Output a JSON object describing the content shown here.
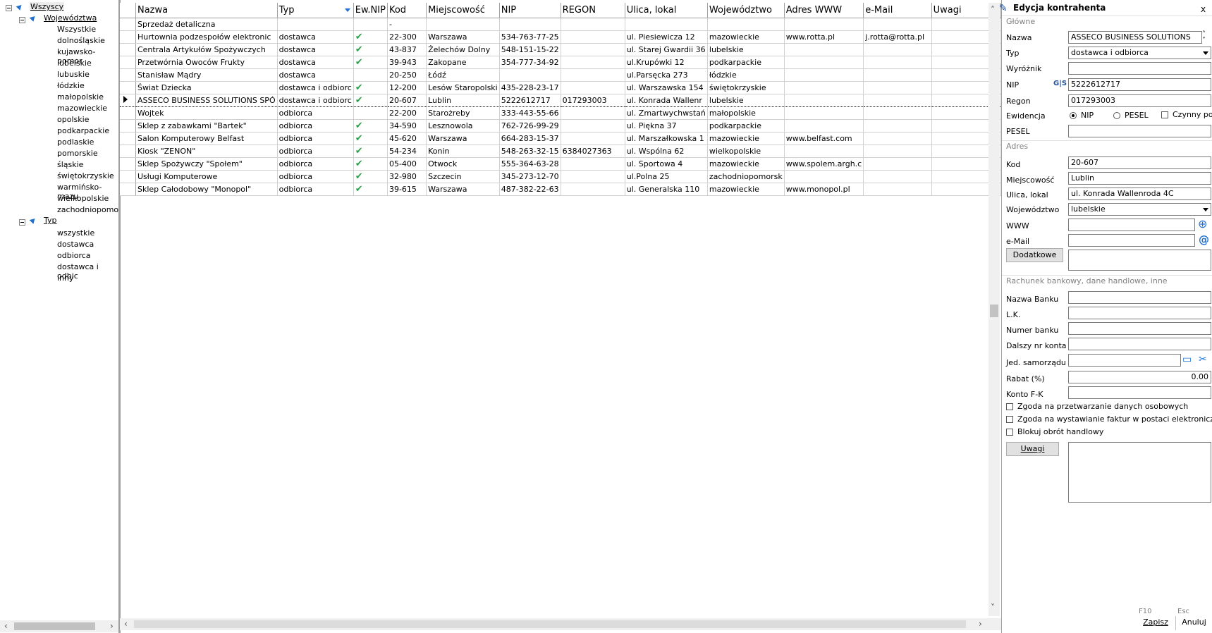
{
  "tree": {
    "root": "Wszyscy",
    "group1": "Województwa",
    "voivodeships": [
      "Wszystkie",
      "dolnośląskie",
      "kujawsko-pomor",
      "lubelskie",
      "lubuskie",
      "łódzkie",
      "małopolskie",
      "mazowieckie",
      "opolskie",
      "podkarpackie",
      "podlaskie",
      "pomorskie",
      "śląskie",
      "świętokrzyskie",
      "warmińsko-mazu",
      "wielkopolskie",
      "zachodniopomor"
    ],
    "group2": "Typ",
    "types": [
      "wszystkie",
      "dostawca",
      "odbiorca",
      "dostawca i odbic",
      "inny"
    ]
  },
  "grid": {
    "columns": [
      "Nazwa",
      "Typ",
      "Ew.NIP",
      "Kod",
      "Miejscowość",
      "NIP",
      "REGON",
      "Ulica, lokal",
      "Województwo",
      "Adres WWW",
      "e-Mail",
      "Uwagi"
    ],
    "rows": [
      {
        "nazwa": "Sprzedaż detaliczna",
        "typ": "",
        "ew": "",
        "kod": "-",
        "miasto": "",
        "nip": "",
        "regon": "",
        "ulica": "",
        "woj": "",
        "www": "",
        "email": "",
        "uwagi": ""
      },
      {
        "nazwa": "Hurtownia podzespołów elektronic",
        "typ": "dostawca",
        "ew": "✔",
        "kod": "22-300",
        "miasto": "Warszawa",
        "nip": "534-763-77-25",
        "regon": "",
        "ulica": "ul. Piesiewicza 12",
        "woj": "mazowieckie",
        "www": "www.rotta.pl",
        "email": "j.rotta@rotta.pl",
        "uwagi": ""
      },
      {
        "nazwa": "Centrala Artykułów Spożywczych",
        "typ": "dostawca",
        "ew": "✔",
        "kod": "43-837",
        "miasto": "Żelechów Dolny",
        "nip": "548-151-15-22",
        "regon": "",
        "ulica": "ul. Starej Gwardii 36",
        "woj": "lubelskie",
        "www": "",
        "email": "",
        "uwagi": ""
      },
      {
        "nazwa": "Przetwórnia Owoców Frukty",
        "typ": "dostawca",
        "ew": "✔",
        "kod": "39-943",
        "miasto": "Zakopane",
        "nip": "354-777-34-92",
        "regon": "",
        "ulica": "ul.Krupówki 12",
        "woj": "podkarpackie",
        "www": "",
        "email": "",
        "uwagi": ""
      },
      {
        "nazwa": "Stanisław Mądry",
        "typ": "dostawca",
        "ew": "",
        "kod": "20-250",
        "miasto": "Łódź",
        "nip": "",
        "regon": "",
        "ulica": "ul.Parsęcka 273",
        "woj": "łódzkie",
        "www": "",
        "email": "",
        "uwagi": ""
      },
      {
        "nazwa": "Świat Dziecka",
        "typ": "dostawca i odbiorc",
        "ew": "✔",
        "kod": "12-200",
        "miasto": "Lesów Staropolski",
        "nip": "435-228-23-17",
        "regon": "",
        "ulica": "ul. Warszawska 154",
        "woj": "świętokrzyskie",
        "www": "",
        "email": "",
        "uwagi": ""
      },
      {
        "nazwa": "ASSECO BUSINESS SOLUTIONS SPÓ",
        "typ": "dostawca i odbiorc",
        "ew": "✔",
        "kod": "20-607",
        "miasto": "Lublin",
        "nip": "5222612717",
        "regon": "017293003",
        "ulica": "ul. Konrada Wallenr",
        "woj": "lubelskie",
        "www": "",
        "email": "",
        "uwagi": ""
      },
      {
        "nazwa": "Wojtek",
        "typ": "odbiorca",
        "ew": "",
        "kod": "22-200",
        "miasto": "Starożreby",
        "nip": "333-443-55-66",
        "regon": "",
        "ulica": "ul. Zmartwychwstań",
        "woj": "małopolskie",
        "www": "",
        "email": "",
        "uwagi": ""
      },
      {
        "nazwa": "Sklep z zabawkami \"Bartek\"",
        "typ": "odbiorca",
        "ew": "✔",
        "kod": "34-590",
        "miasto": "Lesznowola",
        "nip": "762-726-99-29",
        "regon": "",
        "ulica": "ul. Piękna 37",
        "woj": "podkarpackie",
        "www": "",
        "email": "",
        "uwagi": ""
      },
      {
        "nazwa": "Salon Komputerowy Belfast",
        "typ": "odbiorca",
        "ew": "✔",
        "kod": "45-620",
        "miasto": "Warszawa",
        "nip": "664-283-15-37",
        "regon": "",
        "ulica": "ul. Marszałkowska 1",
        "woj": "mazowieckie",
        "www": "www.belfast.com",
        "email": "",
        "uwagi": ""
      },
      {
        "nazwa": "Kiosk \"ZENON\"",
        "typ": "odbiorca",
        "ew": "✔",
        "kod": "54-234",
        "miasto": "Konin",
        "nip": "548-263-32-15",
        "regon": "6384027363",
        "ulica": "ul. Wspólna 62",
        "woj": "wielkopolskie",
        "www": "",
        "email": "",
        "uwagi": ""
      },
      {
        "nazwa": "Sklep Spożywczy \"Społem\"",
        "typ": "odbiorca",
        "ew": "✔",
        "kod": "05-400",
        "miasto": "Otwock",
        "nip": "555-364-63-28",
        "regon": "",
        "ulica": "ul. Sportowa 4",
        "woj": "mazowieckie",
        "www": "www.spolem.argh.c",
        "email": "",
        "uwagi": ""
      },
      {
        "nazwa": "Usługi Komputerowe",
        "typ": "odbiorca",
        "ew": "✔",
        "kod": "32-980",
        "miasto": "Szczecin",
        "nip": "345-273-12-70",
        "regon": "",
        "ulica": "ul.Polna 25",
        "woj": "zachodniopomorsk",
        "www": "",
        "email": "",
        "uwagi": ""
      },
      {
        "nazwa": "Sklep Całodobowy \"Monopol\"",
        "typ": "odbiorca",
        "ew": "✔",
        "kod": "39-615",
        "miasto": "Warszawa",
        "nip": "487-382-22-63",
        "regon": "",
        "ulica": "ul. Generalska 110",
        "woj": "mazowieckie",
        "www": "www.monopol.pl",
        "email": "",
        "uwagi": ""
      }
    ]
  },
  "panel": {
    "title": "Edycja kontrahenta",
    "section_main": "Główne",
    "nazwa_label": "Nazwa",
    "nazwa_value": "ASSECO BUSINESS SOLUTIONS",
    "typ_label": "Typ",
    "typ_value": "dostawca i odbiorca",
    "wyroznik_label": "Wyróżnik",
    "wyroznik_value": "",
    "nip_label": "NIP",
    "nip_value": "5222612717",
    "regon_label": "Regon",
    "regon_value": "017293003",
    "ewidencja_label": "Ewidencja",
    "radio_nip": "NIP",
    "radio_pesel": "PESEL",
    "czynny_label": "Czynny po",
    "pesel_label": "PESEL",
    "pesel_value": "",
    "section_address": "Adres",
    "kod_label": "Kod",
    "kod_value": "20-607",
    "miejscowosc_label": "Miejscowość",
    "miejscowosc_value": "Lublin",
    "ulica_label": "Ulica, lokal",
    "ulica_value": "ul. Konrada Wallenroda 4C",
    "woj_label": "Województwo",
    "woj_value": "lubelskie",
    "www_label": "WWW",
    "www_value": "",
    "email_label": "e-Mail",
    "email_value": "",
    "dodatkowe_button": "Dodatkowe",
    "section_bank": "Rachunek bankowy, dane handlowe, inne",
    "bank_label": "Nazwa Banku",
    "lk_label": "L.K.",
    "numer_label": "Numer banku",
    "dalszy_label": "Dalszy nr konta",
    "jst_label": "Jed. samorządu",
    "rabat_label": "Rabat (%)",
    "rabat_value": "0.00",
    "konto_label": "Konto F-K",
    "zgoda1": "Zgoda na przetwarzanie danych osobowych",
    "zgoda2": "Zgoda na wystawianie faktur w postaci elektronicznej",
    "blokuj": "Blokuj obrót handlowy",
    "uwagi_button": "Uwagi",
    "f10": "F10",
    "esc": "Esc",
    "zapisz_button": "Zapisz",
    "anuluj_button": "Anuluj",
    "close": "x"
  }
}
